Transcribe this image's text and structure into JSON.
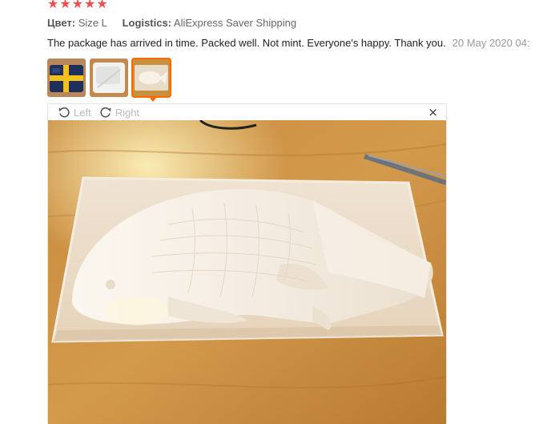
{
  "rating": {
    "stars": 5,
    "star_glyph": "★",
    "color": "#f04d4d"
  },
  "meta": {
    "color_label": "Цвет:",
    "color_value": "Size L",
    "logistics_label": "Logistics:",
    "logistics_value": "AliExpress Saver Shipping"
  },
  "review": {
    "text": "The package has arrived in time. Packed well. Not mint. Everyone's happy. Thank you.",
    "date": "20 May 2020 04:"
  },
  "thumbnails": [
    {
      "icon": "package-blue-yellow-thumbnail",
      "active": false
    },
    {
      "icon": "white-package-thumbnail",
      "active": false
    },
    {
      "icon": "fish-mold-thumbnail",
      "active": true
    }
  ],
  "viewer": {
    "rotate_left": "Left",
    "rotate_right": "Right",
    "close_glyph": "×"
  },
  "colors": {
    "accent": "#ff6a00",
    "muted": "#999999"
  }
}
